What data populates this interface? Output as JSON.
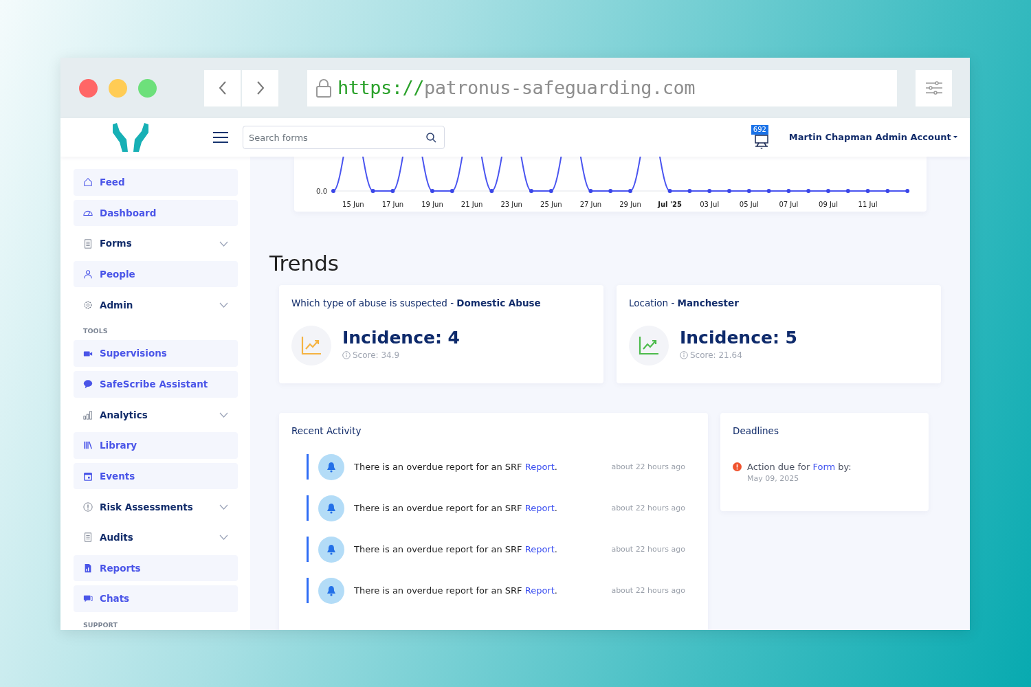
{
  "browser": {
    "url": {
      "scheme": "https://",
      "host": "patronus-safeguarding.com"
    }
  },
  "header": {
    "search": {
      "placeholder": "Search forms"
    },
    "notifications": "692",
    "user": "Martin Chapman Admin Account"
  },
  "sidebar": {
    "items": [
      {
        "kind": "link",
        "label": "Feed"
      },
      {
        "kind": "link",
        "label": "Dashboard"
      },
      {
        "kind": "group",
        "label": "Forms"
      },
      {
        "kind": "link",
        "label": "People"
      },
      {
        "kind": "group",
        "label": "Admin"
      },
      {
        "kind": "heading",
        "label": "TOOLS"
      },
      {
        "kind": "link",
        "label": "Supervisions"
      },
      {
        "kind": "link",
        "label": "SafeScribe Assistant"
      },
      {
        "kind": "group",
        "label": "Analytics"
      },
      {
        "kind": "link",
        "label": "Library"
      },
      {
        "kind": "link",
        "label": "Events"
      },
      {
        "kind": "group",
        "label": "Risk Assessments"
      },
      {
        "kind": "group",
        "label": "Audits"
      },
      {
        "kind": "link",
        "label": "Reports"
      },
      {
        "kind": "link",
        "label": "Chats"
      },
      {
        "kind": "heading",
        "label": "SUPPORT"
      }
    ]
  },
  "chart": {
    "y_tick": "0.0",
    "x_labels": [
      {
        "label": "15 Jun",
        "bold": false
      },
      {
        "label": "17 Jun",
        "bold": false
      },
      {
        "label": "19 Jun",
        "bold": false
      },
      {
        "label": "21 Jun",
        "bold": false
      },
      {
        "label": "23 Jun",
        "bold": false
      },
      {
        "label": "25 Jun",
        "bold": false
      },
      {
        "label": "27 Jun",
        "bold": false
      },
      {
        "label": "29 Jun",
        "bold": false
      },
      {
        "label": "Jul '25",
        "bold": true
      },
      {
        "label": "03 Jul",
        "bold": false
      },
      {
        "label": "05 Jul",
        "bold": false
      },
      {
        "label": "07 Jul",
        "bold": false
      },
      {
        "label": "09 Jul",
        "bold": false
      },
      {
        "label": "11 Jul",
        "bold": false
      }
    ]
  },
  "trends": {
    "title": "Trends",
    "cards": [
      {
        "title": "Which type of abuse is suspected - **Domestic Abuse**",
        "incidence": "Incidence: 4",
        "score": "Score: 34.9",
        "color": "#f5b342"
      },
      {
        "title": "Location - **Manchester**",
        "incidence": "Incidence: 5",
        "score": "Score: 21.64",
        "color": "#4cbb4c"
      }
    ]
  },
  "recent_activity": {
    "title": "Recent Activity",
    "items": [
      {
        "text": "There is an overdue report for an SRF ",
        "link": "Report",
        "suffix": ".",
        "time": "about 22 hours ago"
      },
      {
        "text": "There is an overdue report for an SRF ",
        "link": "Report",
        "suffix": ".",
        "time": "about 22 hours ago"
      },
      {
        "text": "There is an overdue report for an SRF ",
        "link": "Report",
        "suffix": ".",
        "time": "about 22 hours ago"
      },
      {
        "text": "There is an overdue report for an SRF ",
        "link": "Report",
        "suffix": ".",
        "time": "about 22 hours ago"
      }
    ]
  },
  "deadlines": {
    "title": "Deadlines",
    "items": [
      {
        "text": "Action due for ",
        "link": "Form",
        "suffix": " by:",
        "date": "May 09, 2025"
      }
    ]
  }
}
